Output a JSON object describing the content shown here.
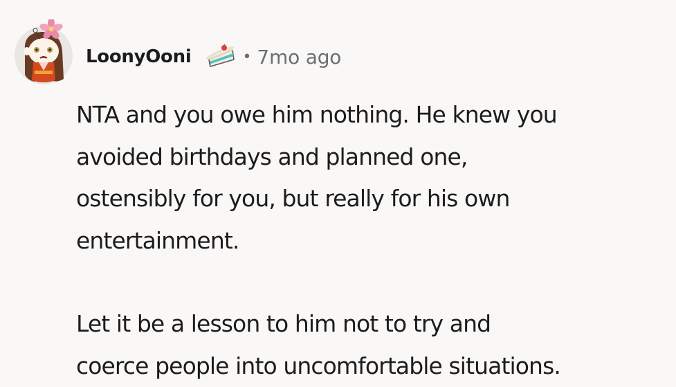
{
  "comment": {
    "author": "LoonyOoni",
    "separator": "•",
    "timestamp": "7mo ago",
    "avatar_icon": "snoo-avatar-icon",
    "flair_icon": "cake-slice-icon",
    "paragraphs": [
      {
        "lines": [
          "NTA and you owe him nothing. He knew you",
          "avoided birthdays and planned one,",
          "ostensibly for you, but really for his own",
          "entertainment."
        ]
      },
      {
        "lines": [
          "Let it be a lesson to him not to try and",
          "coerce people into uncomfortable situations."
        ]
      }
    ]
  },
  "colors": {
    "background": "#f9f8f7",
    "text": "#1c1c1c",
    "meta": "#6b6f72"
  }
}
